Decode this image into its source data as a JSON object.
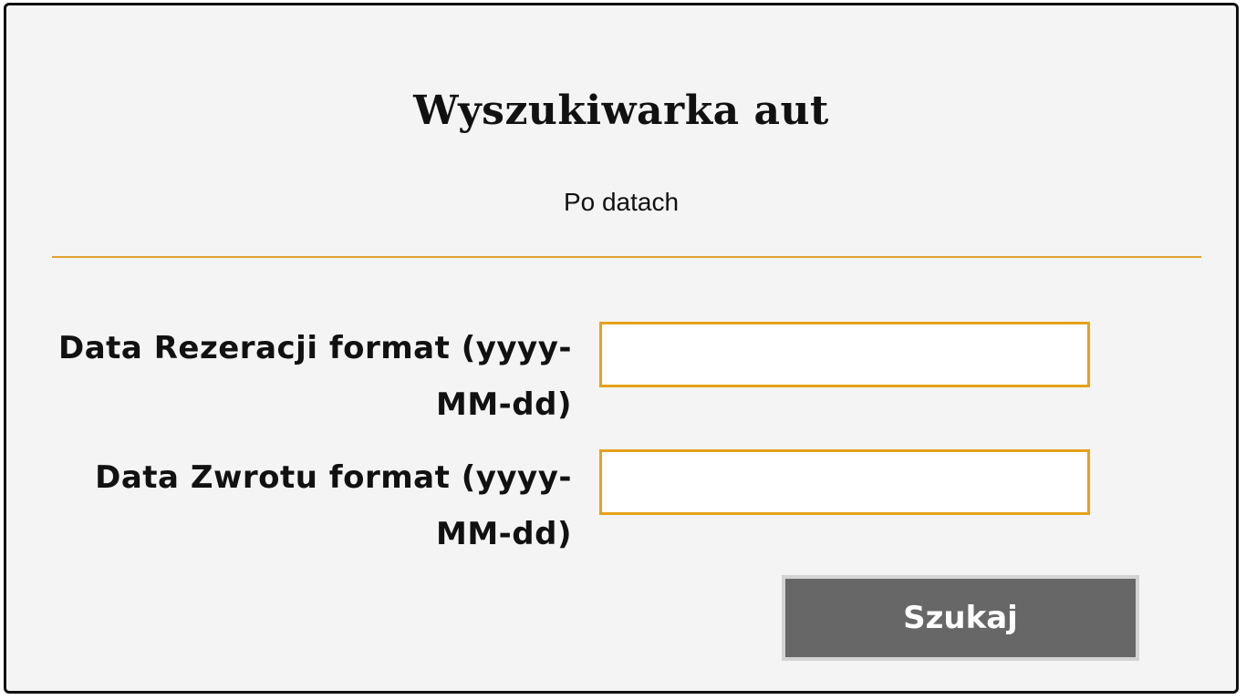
{
  "form": {
    "title": "Wyszukiwarka aut",
    "subtitle": "Po datach",
    "fields": [
      {
        "label": "Data Rezeracji format (yyyy-MM-dd)",
        "value": ""
      },
      {
        "label": "Data Zwrotu format (yyyy-MM-dd)",
        "value": ""
      }
    ],
    "submit_label": "Szukaj"
  },
  "colors": {
    "accent": "#e6a21a",
    "button_bg": "#676767",
    "panel_bg": "#f4f4f4"
  }
}
